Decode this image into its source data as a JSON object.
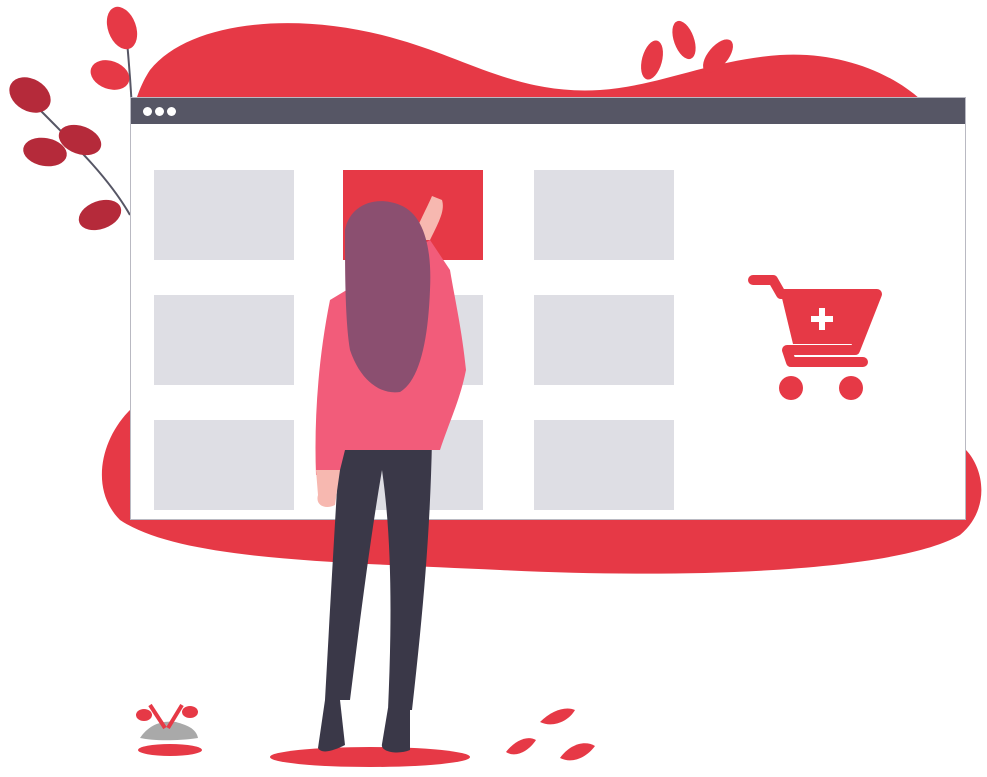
{
  "colors": {
    "accent": "#e63946",
    "title_bar": "#565665",
    "tile": "#dedee4",
    "leaf_dark": "#b52a3a",
    "shirt": "#f25c7a",
    "hair": "#8b4f70",
    "pants": "#3a3848",
    "skin": "#f7b8b0"
  },
  "window": {
    "title_dots": 3,
    "tiles_count": 9,
    "selected_tile_index": 1
  },
  "icons": {
    "cart": "add-to-cart-icon",
    "window_controls": "window-dots-icon"
  }
}
